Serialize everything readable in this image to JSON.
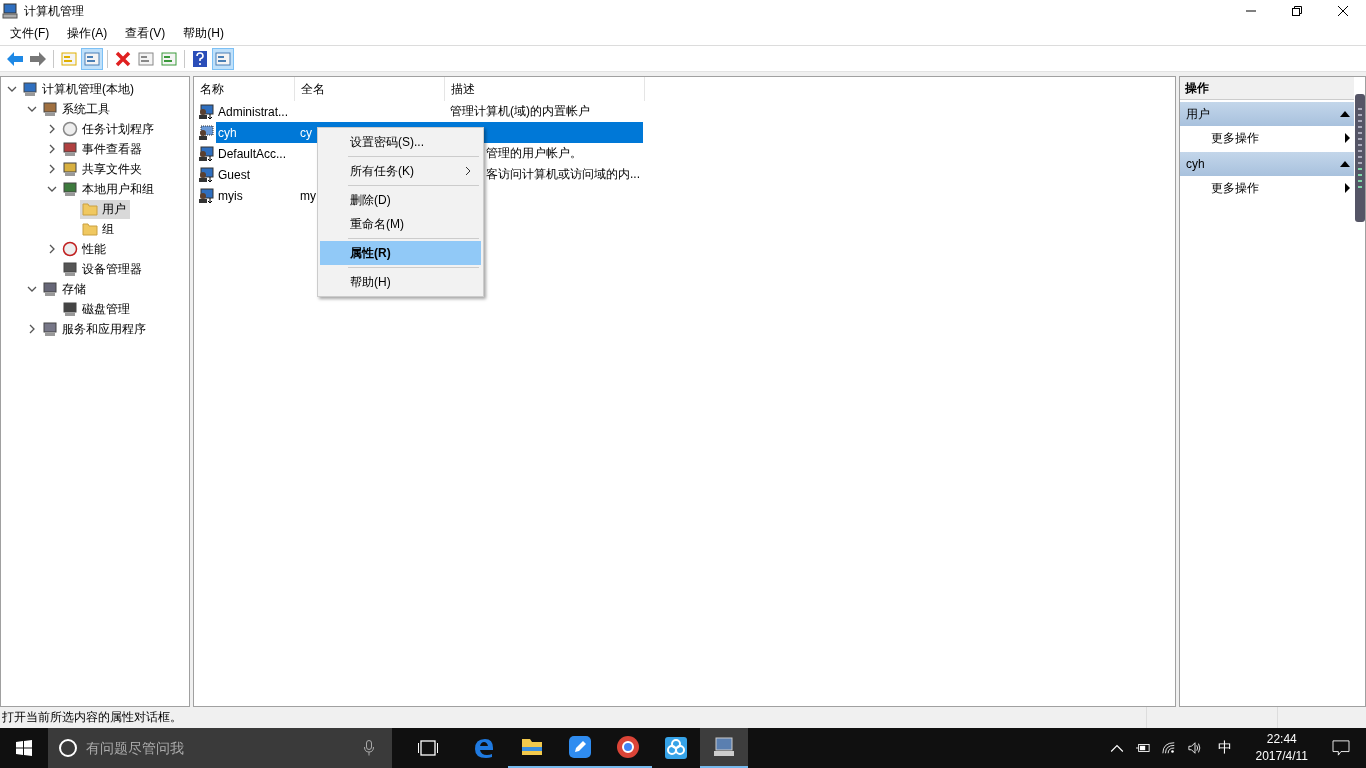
{
  "window": {
    "title": "计算机管理"
  },
  "menu": [
    "文件(F)",
    "操作(A)",
    "查看(V)",
    "帮助(H)"
  ],
  "toolbar": [
    {
      "kind": "back",
      "pressed": false
    },
    {
      "kind": "forward",
      "pressed": false
    },
    {
      "kind": "separator"
    },
    {
      "kind": "up",
      "pressed": false
    },
    {
      "kind": "tree",
      "pressed": true
    },
    {
      "kind": "separator"
    },
    {
      "kind": "delete",
      "pressed": false
    },
    {
      "kind": "properties",
      "pressed": false
    },
    {
      "kind": "export",
      "pressed": false
    },
    {
      "kind": "separator"
    },
    {
      "kind": "help",
      "pressed": false
    },
    {
      "kind": "actionpane",
      "pressed": true
    }
  ],
  "tree": [
    {
      "label": "计算机管理(本地)",
      "expanded": true,
      "selected": false,
      "children": [
        {
          "label": "系统工具",
          "expanded": true,
          "selected": false,
          "children": [
            {
              "label": "任务计划程序",
              "expanded": false,
              "selected": false
            },
            {
              "label": "事件查看器",
              "expanded": false,
              "selected": false
            },
            {
              "label": "共享文件夹",
              "expanded": false,
              "selected": false
            },
            {
              "label": "本地用户和组",
              "expanded": true,
              "selected": false,
              "children": [
                {
                  "label": "用户",
                  "selected": true
                },
                {
                  "label": "组",
                  "selected": false
                }
              ]
            },
            {
              "label": "性能",
              "expanded": false,
              "selected": false
            },
            {
              "label": "设备管理器",
              "selected": false
            }
          ]
        },
        {
          "label": "存储",
          "expanded": true,
          "selected": false,
          "children": [
            {
              "label": "磁盘管理",
              "selected": false
            }
          ]
        },
        {
          "label": "服务和应用程序",
          "expanded": false,
          "selected": false
        }
      ]
    }
  ],
  "table": {
    "columns": [
      "名称",
      "全名",
      "描述"
    ],
    "rows": [
      {
        "name": "Administrat...",
        "description": "管理计算机(域)的内置帐户",
        "description_covered": false,
        "selected": false,
        "disabled": false
      },
      {
        "name": "cyh",
        "full_name": "cy",
        "selected": true,
        "disabled": true
      },
      {
        "name": "DefaultAcc...",
        "description": "管理的用户帐户。",
        "description_covered": true,
        "selected": false,
        "disabled": false
      },
      {
        "name": "Guest",
        "description": "客访问计算机或访问域的内...",
        "description_covered": true,
        "selected": false,
        "disabled": false
      },
      {
        "name": "myis",
        "full_name": "my",
        "selected": false,
        "disabled": false
      }
    ]
  },
  "context_menu": [
    {
      "kind": "item",
      "label": "设置密码(S)...",
      "submenu": false,
      "selected": false,
      "default": false
    },
    {
      "kind": "separator"
    },
    {
      "kind": "item",
      "label": "所有任务(K)",
      "submenu": true,
      "selected": false,
      "default": false
    },
    {
      "kind": "separator"
    },
    {
      "kind": "item",
      "label": "删除(D)",
      "submenu": false,
      "selected": false,
      "default": false
    },
    {
      "kind": "item",
      "label": "重命名(M)",
      "submenu": false,
      "selected": false,
      "default": false
    },
    {
      "kind": "separator"
    },
    {
      "kind": "item",
      "label": "属性(R)",
      "submenu": false,
      "selected": true,
      "default": true
    },
    {
      "kind": "separator"
    },
    {
      "kind": "item",
      "label": "帮助(H)",
      "submenu": false,
      "selected": false,
      "default": false
    }
  ],
  "actions": {
    "title": "操作",
    "sections": [
      {
        "title": "用户",
        "expanded": true,
        "items": [
          "更多操作"
        ]
      },
      {
        "title": "cyh",
        "expanded": true,
        "items": [
          "更多操作"
        ]
      }
    ]
  },
  "status_bar": "打开当前所选内容的属性对话框。",
  "taskbar": {
    "search": {
      "placeholder": "有问题尽管问我"
    },
    "apps": [
      {
        "kind": "edge",
        "active": false,
        "running": false
      },
      {
        "kind": "explorer",
        "active": false,
        "running": true
      },
      {
        "kind": "pen",
        "active": false,
        "running": true
      },
      {
        "kind": "chrome",
        "active": false,
        "running": true
      },
      {
        "kind": "cloud",
        "active": false,
        "running": false
      },
      {
        "kind": "compmgmt",
        "active": true,
        "running": true
      }
    ],
    "ime": "中",
    "time": "22:44",
    "date": "2017/4/11"
  }
}
